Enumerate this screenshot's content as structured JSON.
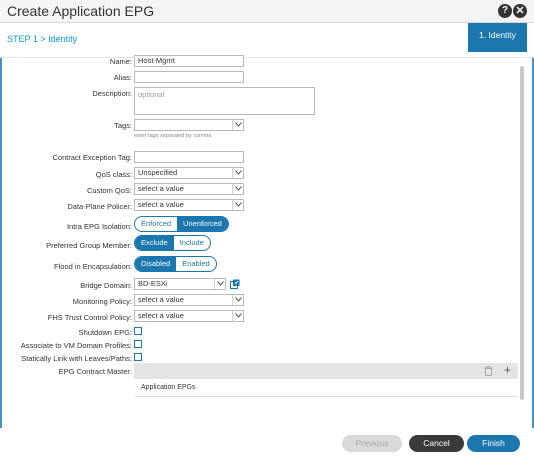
{
  "dialog": {
    "title": "Create Application EPG",
    "help_glyph": "?",
    "close_glyph": "✕"
  },
  "steps": {
    "current_label": "STEP 1 > Identity",
    "tab_label": "1. Identity"
  },
  "form": {
    "name": {
      "label": "Name:",
      "value": "Host-Mgmt"
    },
    "alias": {
      "label": "Alias:",
      "value": ""
    },
    "description": {
      "label": "Description:",
      "placeholder": "optional"
    },
    "tags": {
      "label": "Tags:",
      "value": "",
      "hint": "enter tags separated by comma"
    },
    "contract_exception_tag": {
      "label": "Contract Exception Tag:",
      "value": ""
    },
    "qos_class": {
      "label": "QoS class:",
      "value": "Unspecified"
    },
    "custom_qos": {
      "label": "Custom QoS:",
      "value": "select a value"
    },
    "data_plane_policer": {
      "label": "Data-Plane Policer:",
      "value": "select a value"
    },
    "intra_epg_isolation": {
      "label": "Intra EPG Isolation:",
      "options": [
        "Enforced",
        "Unenforced"
      ],
      "selected": "Unenforced"
    },
    "preferred_group_member": {
      "label": "Preferred Group Member:",
      "options": [
        "Exclude",
        "Include"
      ],
      "selected": "Exclude"
    },
    "flood_in_encapsulation": {
      "label": "Flood in Encapsulation:",
      "options": [
        "Disabled",
        "Enabled"
      ],
      "selected": "Disabled"
    },
    "bridge_domain": {
      "label": "Bridge Domain:",
      "value": "BD-ESXi"
    },
    "monitoring_policy": {
      "label": "Monitoring Policy:",
      "value": "select a value"
    },
    "fhs_trust_control_policy": {
      "label": "FHS Trust Control Policy:",
      "value": "select a value"
    },
    "shutdown_epg": {
      "label": "Shutdown EPG:",
      "checked": false
    },
    "associate_vm_domain": {
      "label": "Associate to VM Domain Profiles:",
      "checked": false
    },
    "static_link_leaves": {
      "label": "Statically Link with Leaves/Paths:",
      "checked": false
    },
    "epg_contract_master": {
      "label": "EPG Contract Master:",
      "column_header": "Application EPGs"
    }
  },
  "footer": {
    "previous_label": "Previous",
    "cancel_label": "Cancel",
    "finish_label": "Finish"
  },
  "colors": {
    "accent": "#1b77ad",
    "link": "#049fd9",
    "cancel": "#3a3a3a"
  }
}
